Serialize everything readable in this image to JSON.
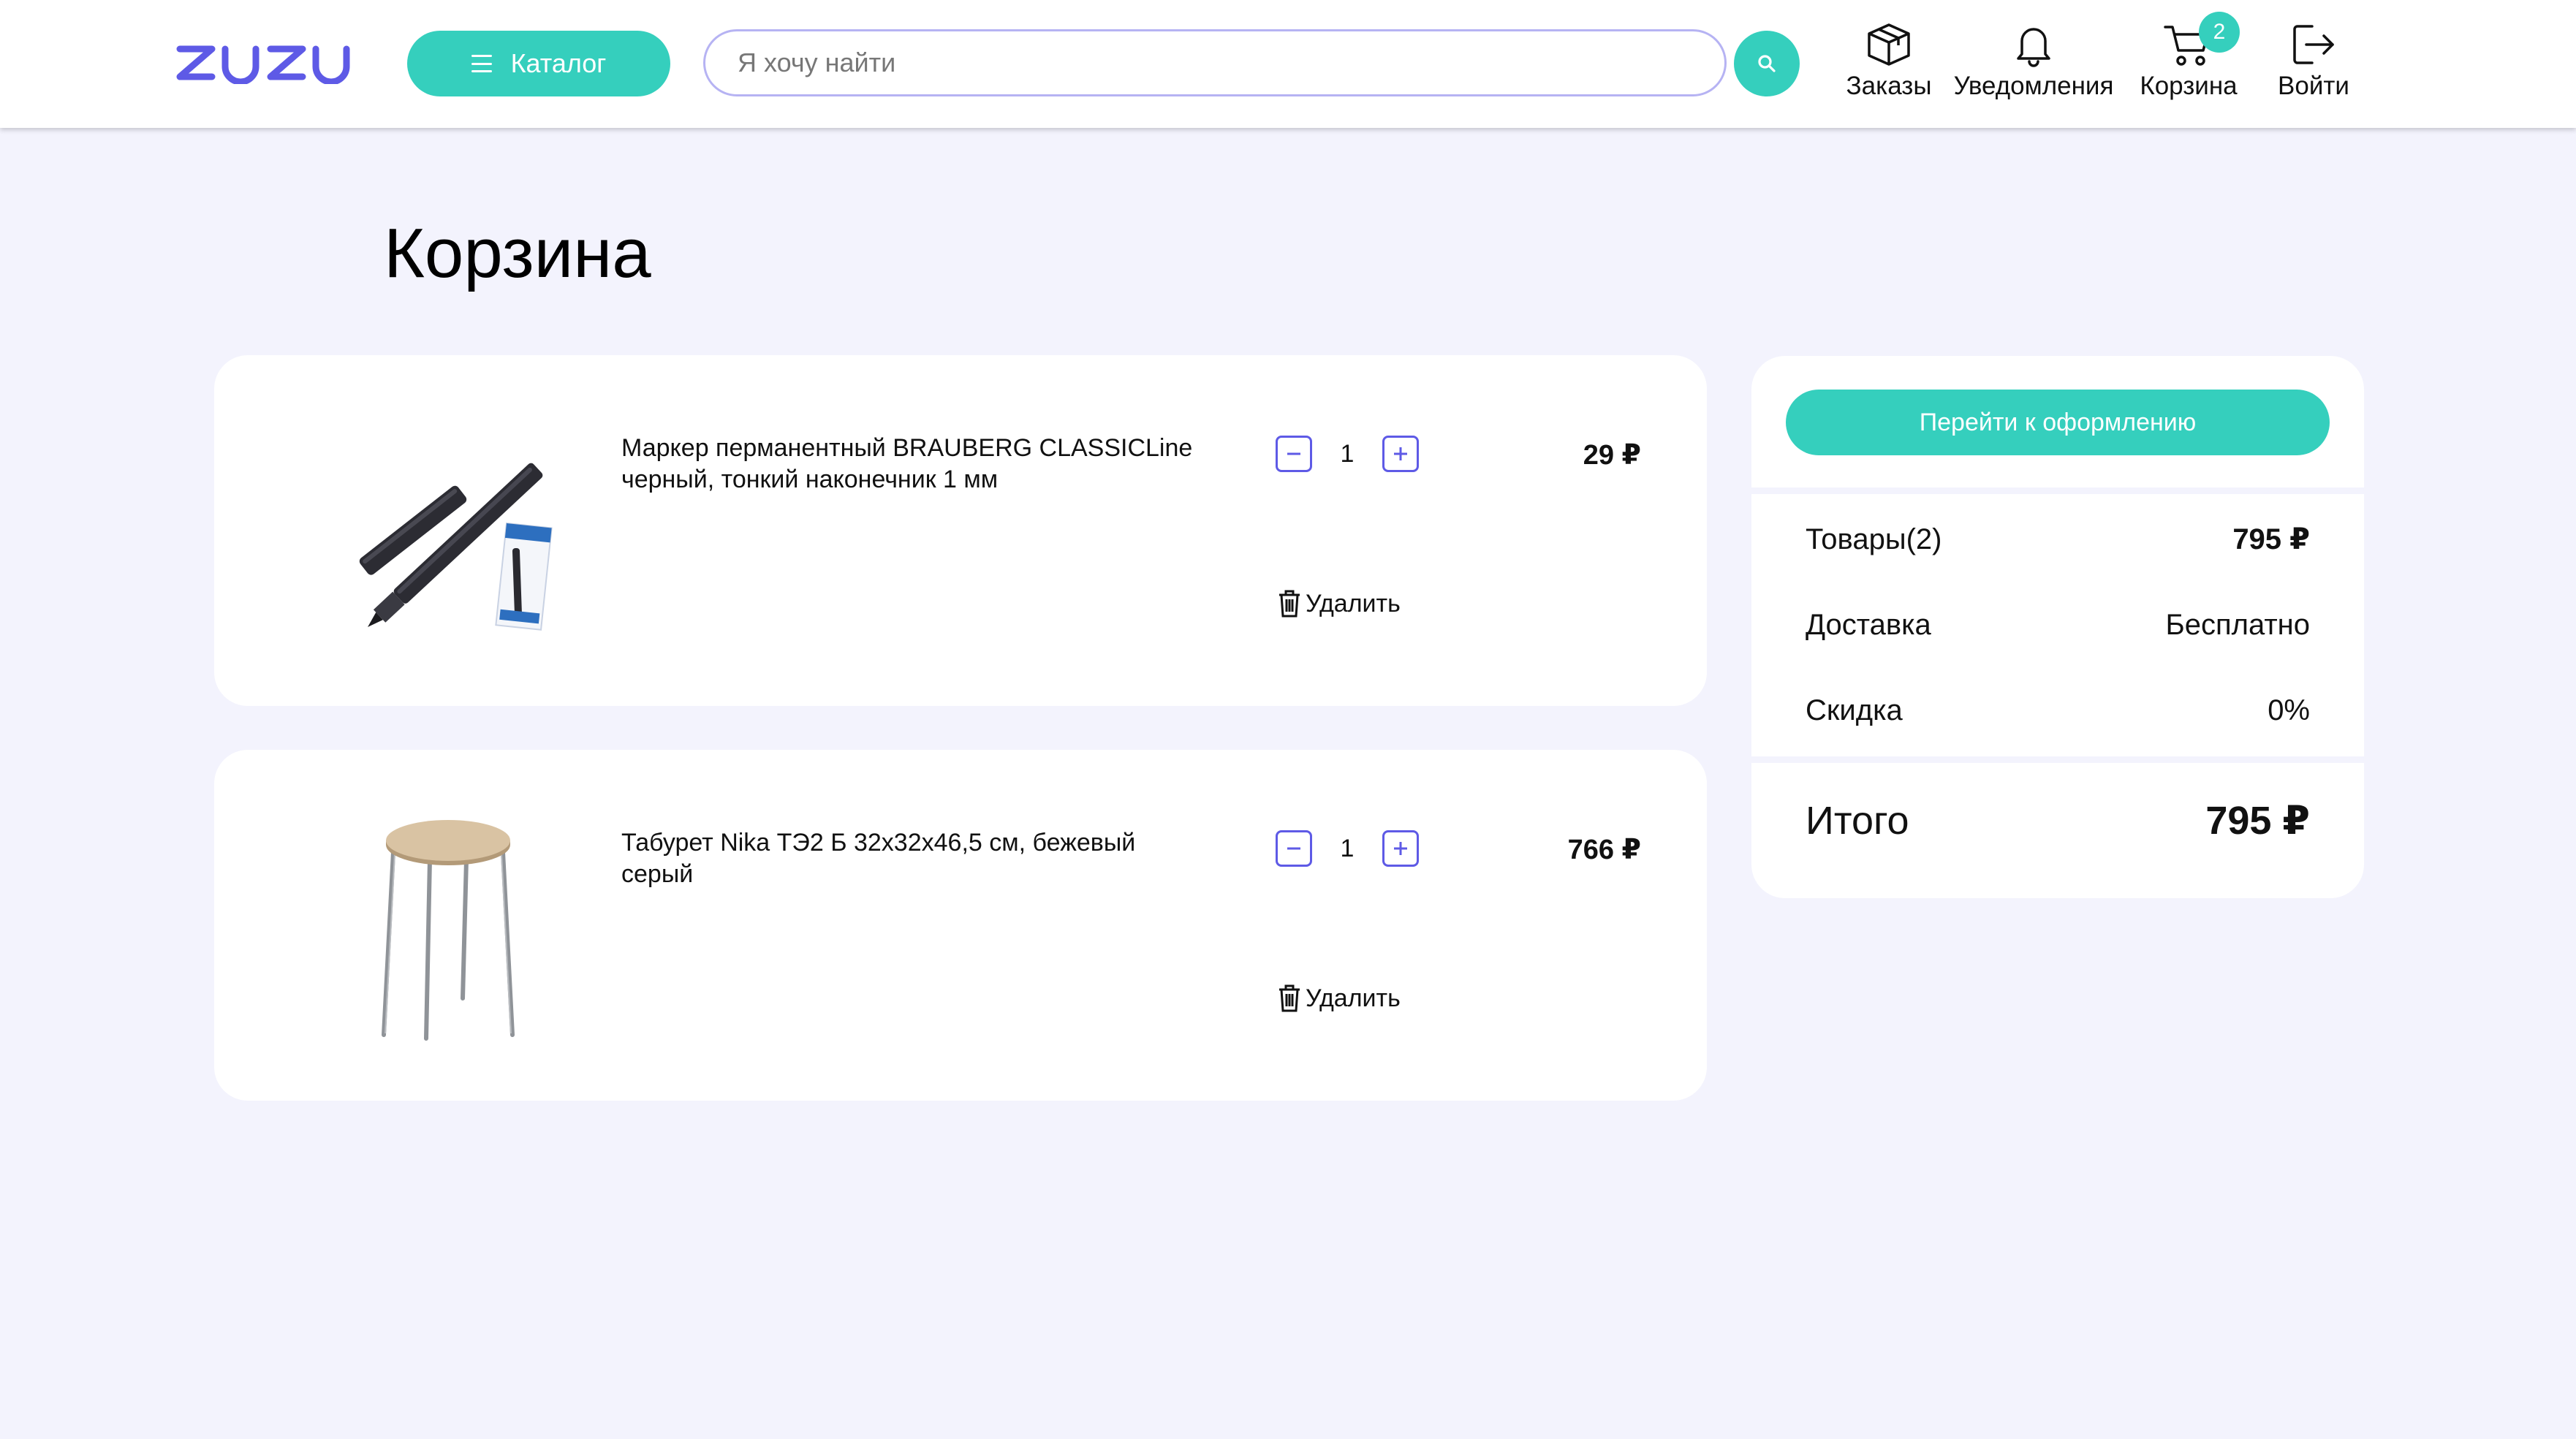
{
  "header": {
    "logo_text": "ZUZU",
    "catalog_label": "Каталог",
    "search_placeholder": "Я хочу найти",
    "nav": {
      "orders": "Заказы",
      "notifications": "Уведомления",
      "cart": "Корзина",
      "cart_count": "2",
      "login": "Войти"
    }
  },
  "page": {
    "title": "Корзина"
  },
  "cart_items": [
    {
      "name": "Маркер перманентный BRAUBERG CLASSICLine черный, тонкий наконечник 1 мм",
      "quantity": "1",
      "price": "29 ₽",
      "delete_label": "Удалить",
      "image": "marker-image",
      "package_brand": "BRAUBERG"
    },
    {
      "name": "Табурет Nika ТЭ2 Б 32х32х46,5 см, бежевый серый",
      "quantity": "1",
      "price": "766 ₽",
      "delete_label": "Удалить",
      "image": "stool-image"
    }
  ],
  "summary": {
    "checkout_label": "Перейти к оформлению",
    "goods_label": "Товары(2)",
    "goods_value": "795 ₽",
    "delivery_label": "Доставка",
    "delivery_value": "Бесплатно",
    "discount_label": "Скидка",
    "discount_value": "0%",
    "total_label": "Итого",
    "total_value": "795 ₽"
  },
  "colors": {
    "accent": "#35cfbd",
    "brand": "#5e5ae6",
    "background": "#f3f3fd"
  }
}
